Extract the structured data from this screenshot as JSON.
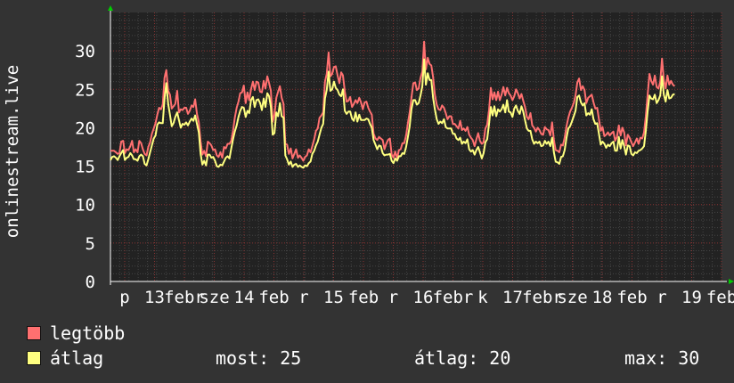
{
  "chart_data": {
    "type": "line",
    "ylabel": "onlinestream.live",
    "ylim": [
      0,
      35
    ],
    "yticks": [
      0,
      5,
      10,
      15,
      20,
      25,
      30
    ],
    "grid": true,
    "x": [
      0,
      1,
      2,
      3,
      4,
      5,
      6,
      7,
      8,
      9,
      10,
      11,
      12,
      13,
      14,
      15,
      16,
      17,
      18,
      19,
      20,
      21,
      22,
      23,
      24,
      25,
      26,
      27,
      28,
      29,
      30,
      31,
      32,
      33,
      34,
      35,
      36,
      37,
      38,
      39,
      40,
      41,
      42,
      43,
      44,
      45,
      46,
      47,
      48,
      49,
      50,
      51,
      52,
      53,
      54,
      55,
      56,
      57,
      58,
      59,
      60,
      61,
      62,
      63,
      64,
      65,
      66,
      67,
      68,
      69,
      70,
      71,
      72,
      73,
      74,
      75,
      76,
      77,
      78,
      79,
      80,
      81,
      82,
      83,
      84,
      85,
      86,
      87,
      88,
      89,
      90,
      91,
      92,
      93,
      94,
      95,
      96,
      97,
      98,
      99,
      100,
      101,
      102,
      103,
      104,
      105,
      106,
      107,
      108,
      109,
      110,
      111,
      112,
      113,
      114,
      115,
      116,
      117,
      118,
      119,
      120,
      121,
      122,
      123,
      124,
      125,
      126,
      127,
      128,
      129,
      130,
      131,
      132,
      133,
      134,
      135,
      136,
      137,
      138,
      139,
      140,
      141,
      142,
      143,
      144,
      145,
      146,
      147,
      148,
      149,
      150,
      151,
      152,
      153,
      154,
      155,
      156,
      157,
      158,
      159,
      160,
      161,
      162,
      163,
      164,
      165,
      166,
      167,
      168,
      169,
      170,
      171,
      172,
      173,
      174,
      175,
      176,
      177,
      178,
      179,
      180,
      181,
      182,
      183,
      184,
      185,
      186,
      187,
      188,
      189,
      190,
      191,
      192,
      193,
      194,
      195,
      196,
      197,
      198,
      199,
      200,
      201,
      202,
      203,
      204,
      205,
      206,
      207,
      208,
      209,
      210,
      211,
      212,
      213,
      214,
      215,
      216,
      217,
      218,
      219,
      220,
      221,
      222,
      223,
      224,
      225,
      226,
      227,
      228,
      229,
      230,
      231,
      232,
      233,
      234,
      235,
      236,
      237,
      238,
      239,
      240,
      241,
      242,
      243,
      244,
      245,
      246,
      247,
      248,
      249,
      250,
      251,
      252,
      253,
      254,
      255,
      256,
      257,
      258,
      259,
      260,
      261,
      262,
      263,
      264,
      265,
      266,
      267,
      268,
      269,
      270,
      271,
      272,
      273,
      274,
      275,
      276,
      277,
      278,
      279,
      280,
      281,
      282,
      283,
      284,
      285,
      286,
      287,
      288,
      289,
      290,
      291,
      292,
      293,
      294,
      295,
      296,
      297,
      298,
      299,
      300,
      301,
      302,
      303,
      304,
      305,
      306,
      307,
      308,
      309,
      310,
      311,
      312,
      313,
      314,
      315,
      316,
      317,
      318,
      319,
      320,
      321,
      322,
      323,
      324,
      325,
      326,
      327,
      328,
      329,
      330,
      331,
      332,
      333,
      334,
      335,
      336,
      337,
      338,
      339
    ],
    "xtick_labels": [
      "p",
      "13",
      "febr",
      "sze",
      "14",
      "feb",
      "r",
      "15",
      "feb",
      "r",
      "16",
      "febr",
      "k",
      "17",
      "febr",
      "sze",
      "18",
      "feb",
      "r",
      "19",
      "feb"
    ],
    "series": [
      {
        "name": "legtöbb",
        "color": "#ff7070",
        "values": [
          17.0,
          17.0,
          17.0,
          16.8,
          16.6,
          16.7,
          18.2,
          18.3,
          16.7,
          17.2,
          17.1,
          17.6,
          18.3,
          16.8,
          17.2,
          16.8,
          18.3,
          18.0,
          17.2,
          16.6,
          16.4,
          17.5,
          18.1,
          19.2,
          19.9,
          20.6,
          21.7,
          22.6,
          22.4,
          23.0,
          26.5,
          27.5,
          24.8,
          24.3,
          22.5,
          22.8,
          23.1,
          24.8,
          22.0,
          22.4,
          22.3,
          22.6,
          22.6,
          21.8,
          22.2,
          22.9,
          22.7,
          23.7,
          21.8,
          20.7,
          18.2,
          16.5,
          17.0,
          16.3,
          18.2,
          18.0,
          17.7,
          17.1,
          17.2,
          16.4,
          16.2,
          16.8,
          16.1,
          17.5,
          17.3,
          17.9,
          17.9,
          18.3,
          19.6,
          21.3,
          22.6,
          23.4,
          24.5,
          24.6,
          25.5,
          23.2,
          24.6,
          23.6,
          25.0,
          26.0,
          24.9,
          26.0,
          25.9,
          24.7,
          24.6,
          26.1,
          25.1,
          26.7,
          25.8,
          24.8,
          20.8,
          21.7,
          23.9,
          24.7,
          25.4,
          23.9,
          23.1,
          17.9,
          17.8,
          16.6,
          17.3,
          16.0,
          16.6,
          17.2,
          16.1,
          16.4,
          16.1,
          15.7,
          16.2,
          16.4,
          17.2,
          16.8,
          17.6,
          18.5,
          19.6,
          19.9,
          21.3,
          21.6,
          22.0,
          26.0,
          27.0,
          29.8,
          26.7,
          27.0,
          27.9,
          28.0,
          26.8,
          25.8,
          27.2,
          26.8,
          24.7,
          23.4,
          23.5,
          24.0,
          22.7,
          23.1,
          23.6,
          23.2,
          23.9,
          23.3,
          22.4,
          23.3,
          23.4,
          22.6,
          22.1,
          21.7,
          19.2,
          18.6,
          18.4,
          18.8,
          18.6,
          18.4,
          17.2,
          17.9,
          18.4,
          18.6,
          16.5,
          16.1,
          16.9,
          16.0,
          17.1,
          17.2,
          18.0,
          18.0,
          19.0,
          20.6,
          22.0,
          23.9,
          25.8,
          25.9,
          24.9,
          25.1,
          26.5,
          27.3,
          31.2,
          27.6,
          29.1,
          28.3,
          28.1,
          26.6,
          24.3,
          23.0,
          22.4,
          22.3,
          22.9,
          22.6,
          21.9,
          21.1,
          21.5,
          21.5,
          20.5,
          20.5,
          20.2,
          19.9,
          20.9,
          19.7,
          19.9,
          19.6,
          20.1,
          19.1,
          18.7,
          18.4,
          17.6,
          18.5,
          19.3,
          18.3,
          17.9,
          18.1,
          19.9,
          20.4,
          22.3,
          25.2,
          23.7,
          24.6,
          23.6,
          24.7,
          23.6,
          24.3,
          25.3,
          24.2,
          25.2,
          24.5,
          24.2,
          23.6,
          24.1,
          25.0,
          24.5,
          23.8,
          24.4,
          23.5,
          22.7,
          21.4,
          21.1,
          21.9,
          20.3,
          20.0,
          19.5,
          20.0,
          19.7,
          19.2,
          19.1,
          20.1,
          19.8,
          19.7,
          19.0,
          20.7,
          18.4,
          17.1,
          17.0,
          16.8,
          17.8,
          17.7,
          18.7,
          20.2,
          21.3,
          22.1,
          22.6,
          23.2,
          24.2,
          25.9,
          26.4,
          24.9,
          25.4,
          24.9,
          23.2,
          23.9,
          24.1,
          24.3,
          23.3,
          22.5,
          22.6,
          21.1,
          19.6,
          20.1,
          18.9,
          19.1,
          19.4,
          19.0,
          19.3,
          19.5,
          18.3,
          18.8,
          20.3,
          19.0,
          20.0,
          19.4,
          17.7,
          19.1,
          18.7,
          18.1,
          17.6,
          18.1,
          18.6,
          17.9,
          18.7,
          18.6,
          19.4,
          21.5,
          24.2,
          27.0,
          26.1,
          25.6,
          26.8,
          25.3,
          25.1,
          26.0,
          29.0,
          26.2,
          25.1,
          26.8,
          25.6,
          26.1,
          25.6,
          25.4
        ]
      },
      {
        "name": "átlag",
        "color": "#ffff80",
        "values": [
          15.8,
          16.2,
          16.3,
          16.1,
          15.8,
          16.3,
          16.7,
          17.1,
          15.8,
          16.1,
          16.2,
          16.7,
          16.4,
          15.9,
          15.9,
          15.7,
          16.3,
          16.5,
          16.3,
          15.3,
          15.1,
          15.9,
          16.8,
          17.7,
          18.6,
          19.0,
          20.4,
          20.7,
          20.6,
          20.6,
          23.8,
          25.8,
          23.1,
          21.7,
          20.2,
          20.6,
          21.4,
          22.0,
          21.0,
          20.0,
          20.5,
          20.4,
          20.7,
          20.3,
          20.8,
          21.2,
          20.9,
          21.6,
          20.5,
          19.4,
          16.6,
          15.2,
          15.7,
          15.1,
          16.5,
          16.5,
          16.1,
          16.2,
          15.7,
          15.0,
          14.9,
          15.2,
          15.1,
          15.6,
          16.1,
          16.3,
          16.0,
          17.3,
          18.5,
          19.5,
          20.3,
          21.4,
          22.2,
          22.7,
          22.6,
          21.4,
          22.2,
          21.9,
          23.6,
          24.0,
          22.7,
          23.6,
          23.7,
          23.2,
          22.3,
          23.8,
          22.7,
          24.5,
          24.1,
          22.7,
          19.1,
          19.3,
          22.0,
          21.5,
          23.2,
          21.5,
          21.3,
          16.4,
          15.9,
          15.2,
          15.6,
          14.9,
          15.2,
          15.3,
          14.9,
          15.1,
          14.9,
          14.8,
          15.1,
          15.0,
          15.4,
          15.6,
          16.6,
          17.0,
          17.7,
          18.2,
          19.1,
          20.0,
          20.5,
          23.8,
          24.9,
          27.3,
          24.8,
          25.0,
          26.0,
          25.2,
          24.9,
          24.3,
          24.1,
          25.0,
          22.2,
          21.8,
          22.1,
          22.1,
          21.2,
          20.9,
          22.0,
          20.8,
          21.7,
          21.0,
          21.0,
          21.0,
          21.2,
          21.1,
          20.5,
          20.0,
          18.4,
          17.8,
          17.2,
          17.7,
          17.6,
          16.7,
          16.4,
          16.5,
          16.5,
          16.6,
          15.7,
          15.4,
          16.0,
          15.7,
          16.3,
          16.3,
          16.7,
          16.6,
          17.5,
          18.8,
          20.2,
          22.4,
          23.6,
          23.6,
          23.0,
          23.2,
          24.2,
          25.4,
          28.9,
          25.6,
          27.1,
          26.2,
          26.2,
          23.9,
          22.4,
          21.1,
          20.5,
          20.8,
          20.6,
          21.1,
          20.1,
          19.9,
          19.9,
          19.9,
          19.2,
          19.2,
          18.6,
          18.4,
          18.7,
          17.9,
          18.2,
          18.0,
          18.5,
          17.2,
          16.9,
          17.1,
          16.5,
          17.1,
          17.5,
          16.8,
          16.0,
          16.7,
          18.1,
          18.5,
          20.5,
          22.7,
          21.6,
          22.8,
          21.5,
          22.4,
          22.1,
          22.4,
          23.0,
          22.0,
          23.6,
          22.1,
          22.0,
          21.4,
          22.5,
          22.9,
          22.2,
          21.8,
          22.8,
          22.1,
          21.0,
          19.9,
          19.6,
          19.6,
          18.5,
          17.9,
          18.2,
          18.0,
          18.2,
          17.6,
          17.7,
          18.3,
          17.9,
          18.2,
          17.6,
          18.7,
          16.8,
          15.6,
          15.5,
          15.3,
          16.2,
          16.3,
          17.1,
          18.7,
          19.9,
          20.2,
          20.8,
          21.5,
          22.2,
          24.0,
          24.2,
          23.3,
          22.9,
          23.2,
          21.6,
          21.9,
          21.7,
          22.4,
          21.1,
          20.5,
          20.6,
          19.2,
          17.8,
          18.2,
          17.9,
          17.4,
          17.8,
          17.6,
          18.0,
          18.2,
          17.0,
          17.0,
          18.8,
          17.3,
          18.4,
          17.6,
          16.5,
          17.7,
          17.6,
          16.6,
          16.4,
          16.8,
          16.7,
          17.0,
          17.1,
          17.3,
          17.6,
          19.6,
          22.1,
          24.2,
          23.8,
          23.7,
          24.3,
          23.2,
          23.6,
          24.2,
          26.7,
          24.3,
          23.4,
          24.9,
          23.8,
          23.9,
          24.3,
          24.4
        ]
      }
    ]
  },
  "legend": [
    {
      "label": "legtöbb",
      "color": "#ff7070"
    },
    {
      "label": "átlag",
      "color": "#ffff80"
    }
  ],
  "stats": {
    "most_label": "most:",
    "most_value": "25",
    "avg_label": "átlag:",
    "avg_value": "20",
    "max_label": "max:",
    "max_value": "30"
  }
}
